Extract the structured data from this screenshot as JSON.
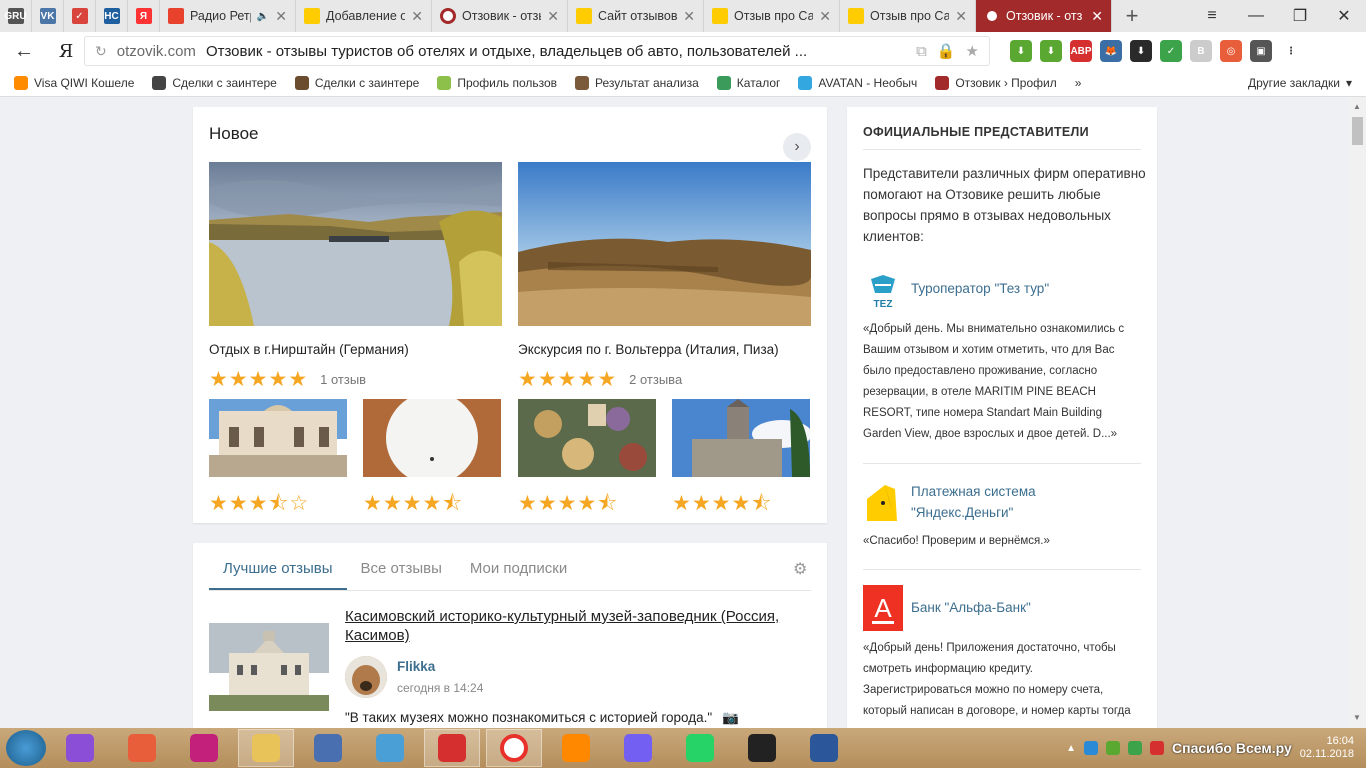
{
  "browser": {
    "pinned_tabs": [
      {
        "icon": "gru-icon",
        "color": "#555555",
        "text": "GRU"
      },
      {
        "icon": "vk-icon",
        "color": "#4a76a8",
        "text": "VK"
      },
      {
        "icon": "todo-check-icon",
        "color": "#d9453d",
        "text": "✓"
      },
      {
        "icon": "nc-icon",
        "color": "#1f5fa0",
        "text": "НС"
      },
      {
        "icon": "yandex-icon",
        "color": "#ff3333",
        "text": "Я"
      }
    ],
    "tabs": [
      {
        "title": "Радио Ретр",
        "icon": "radio-icon",
        "active": false,
        "muted": true
      },
      {
        "title": "Добавление отз",
        "icon": "tab-page-icon",
        "active": false
      },
      {
        "title": "Отзовик - отзыв",
        "icon": "otzovik-icon",
        "active": false
      },
      {
        "title": "Сайт отзывов от",
        "icon": "tab-page-icon",
        "active": false
      },
      {
        "title": "Отзыв про Сайт",
        "icon": "tab-page-icon",
        "active": false
      },
      {
        "title": "Отзыв про Сайт",
        "icon": "tab-page-icon",
        "active": false
      },
      {
        "title": "Отзовик - отз",
        "icon": "otzovik-icon",
        "active": true
      }
    ],
    "new_tab_label": "+",
    "window_controls": {
      "menu": "≡",
      "minimize": "—",
      "restore": "❐",
      "close": "✕"
    },
    "address": {
      "back": "←",
      "yandex_button": "Я",
      "domain": "otzovik.com",
      "page_title": "Отзовик - отзывы туристов об отелях и отдыхе, владельцев об авто, пользователей ...",
      "reload": "↻",
      "star": "★"
    },
    "extensions": [
      {
        "name": "download-green-icon",
        "color": "#5aa832",
        "text": "⬇"
      },
      {
        "name": "download-green-icon-2",
        "color": "#5aa832",
        "text": "⬇"
      },
      {
        "name": "adblock-icon",
        "color": "#d62f2f",
        "text": "ABP"
      },
      {
        "name": "fox-icon",
        "color": "#3a6ea5",
        "text": "🦊"
      },
      {
        "name": "savefrom-icon",
        "color": "#2a2a2a",
        "text": "⬇"
      },
      {
        "name": "shield-icon",
        "color": "#3ca34a",
        "text": "✓"
      },
      {
        "name": "b-ext-icon",
        "color": "#cccccc",
        "text": "B"
      },
      {
        "name": "camera-ext-icon",
        "color": "#e85d3a",
        "text": "◎"
      },
      {
        "name": "screenshot-icon",
        "color": "#555555",
        "text": "▣"
      },
      {
        "name": "menu-icon",
        "color": "#ffffff",
        "text": "⋮"
      }
    ],
    "bookmarks": [
      {
        "label": "Visa QIWI Кошеле",
        "icon": "qiwi-icon",
        "color": "#ff8c00"
      },
      {
        "label": "Сделки с заинтере",
        "icon": "shield-bm-icon",
        "color": "#444444"
      },
      {
        "label": "Сделки с заинтере",
        "icon": "v-bm-icon",
        "color": "#6b4c2e"
      },
      {
        "label": "Профиль пользов",
        "icon": "profile-bm-icon",
        "color": "#8cc04a"
      },
      {
        "label": "Результат анализа",
        "icon": "tool-bm-icon",
        "color": "#7a5a3a"
      },
      {
        "label": "Каталог",
        "icon": "catalog-bm-icon",
        "color": "#3b9b5a"
      },
      {
        "label": "AVATAN - Необыч",
        "icon": "avatan-bm-icon",
        "color": "#33a7e0"
      },
      {
        "label": "Отзовик › Профил",
        "icon": "otzovik-bm-icon",
        "color": "#a32a2a"
      }
    ],
    "bookmarks_more": "»",
    "other_bookmarks": "Другие закладки"
  },
  "new_section": {
    "title": "Новое",
    "next_arrow": "›",
    "featured": [
      {
        "caption": "Отдых в г.Нирштайн (Германия)",
        "rating": 5,
        "count": "1 отзыв"
      },
      {
        "caption": "Экскурсия по г. Вольтерра (Италия, Пиза)",
        "rating": 5,
        "count": "2 отзыва"
      }
    ],
    "small": [
      {
        "rating": 3.5
      },
      {
        "rating": 4.5
      },
      {
        "rating": 4.5
      },
      {
        "rating": 4.5
      }
    ]
  },
  "reviews": {
    "tabs": [
      "Лучшие отзывы",
      "Все отзывы",
      "Мои подписки"
    ],
    "active_tab": 0,
    "settings_icon": "⚙",
    "item": {
      "title": "Касимовский историко-культурный музей-заповедник (Россия, Касимов)",
      "author": "Flikka",
      "date": "сегодня в 14:24",
      "quote": "\"В таких музеях можно познакомиться с историей города.\""
    }
  },
  "reps": {
    "heading": "ОФИЦИАЛЬНЫЕ ПРЕДСТАВИТЕЛИ",
    "intro": "Представители различных фирм оперативно помогают на Отзовике решить любые вопросы прямо в отзывах недовольных клиентов:",
    "items": [
      {
        "name": "Туроператор \"Тез тур\"",
        "text": "«Добрый день. Мы внимательно ознакомились с Вашим отзывом и хотим отметить, что для Вас было предоставлено проживание, согласно резервации, в отеле MARITIM PINE BEACH RESORT, типе номера Standart Main Building Garden View, двое взрослых и двое детей. D...»",
        "logo_color": "#1f7fa8",
        "logo_text": "TEZ"
      },
      {
        "name": "Платежная система \"Яндекс.Деньги\"",
        "text": "«Спасибо! Проверим и вернёмся.»",
        "logo_color": "#ffcc00",
        "logo_text": ""
      },
      {
        "name": "Банк \"Альфа-Банк\"",
        "text": "«Добрый день! Приложения достаточно, чтобы смотреть информацию кредиту. Зарегистрироваться можно по номеру счета, который написан в договоре, и номер карты тогда",
        "logo_color": "#ef3124",
        "logo_text": "А"
      }
    ]
  },
  "taskbar": {
    "apps": [
      {
        "name": "mic-app-icon",
        "color": "#8a4fd6",
        "open": false
      },
      {
        "name": "picasa-app-icon",
        "color": "#e85d3a",
        "open": false
      },
      {
        "name": "camera-app-icon",
        "color": "#c2207a",
        "open": false
      },
      {
        "name": "explorer-app-icon",
        "color": "#e8c35a",
        "open": true
      },
      {
        "name": "speed-app-icon",
        "color": "#4a6fb0",
        "open": false
      },
      {
        "name": "photos-app-icon",
        "color": "#4aa0d6",
        "open": false
      },
      {
        "name": "opera-app-icon",
        "color": "#d62f2f",
        "open": true
      },
      {
        "name": "yandex-browser-app-icon",
        "color": "#ffffff",
        "open": true
      },
      {
        "name": "vlc-app-icon",
        "color": "#ff8800",
        "open": false
      },
      {
        "name": "viber-app-icon",
        "color": "#7360f2",
        "open": false
      },
      {
        "name": "whatsapp-app-icon",
        "color": "#25d366",
        "open": false
      },
      {
        "name": "archicad-app-icon",
        "color": "#222222",
        "open": false
      },
      {
        "name": "word-app-icon",
        "color": "#2b579a",
        "open": false
      }
    ],
    "time": "16:04",
    "date": "02.11.2018",
    "watermark": "Спасибо Всем.ру"
  }
}
